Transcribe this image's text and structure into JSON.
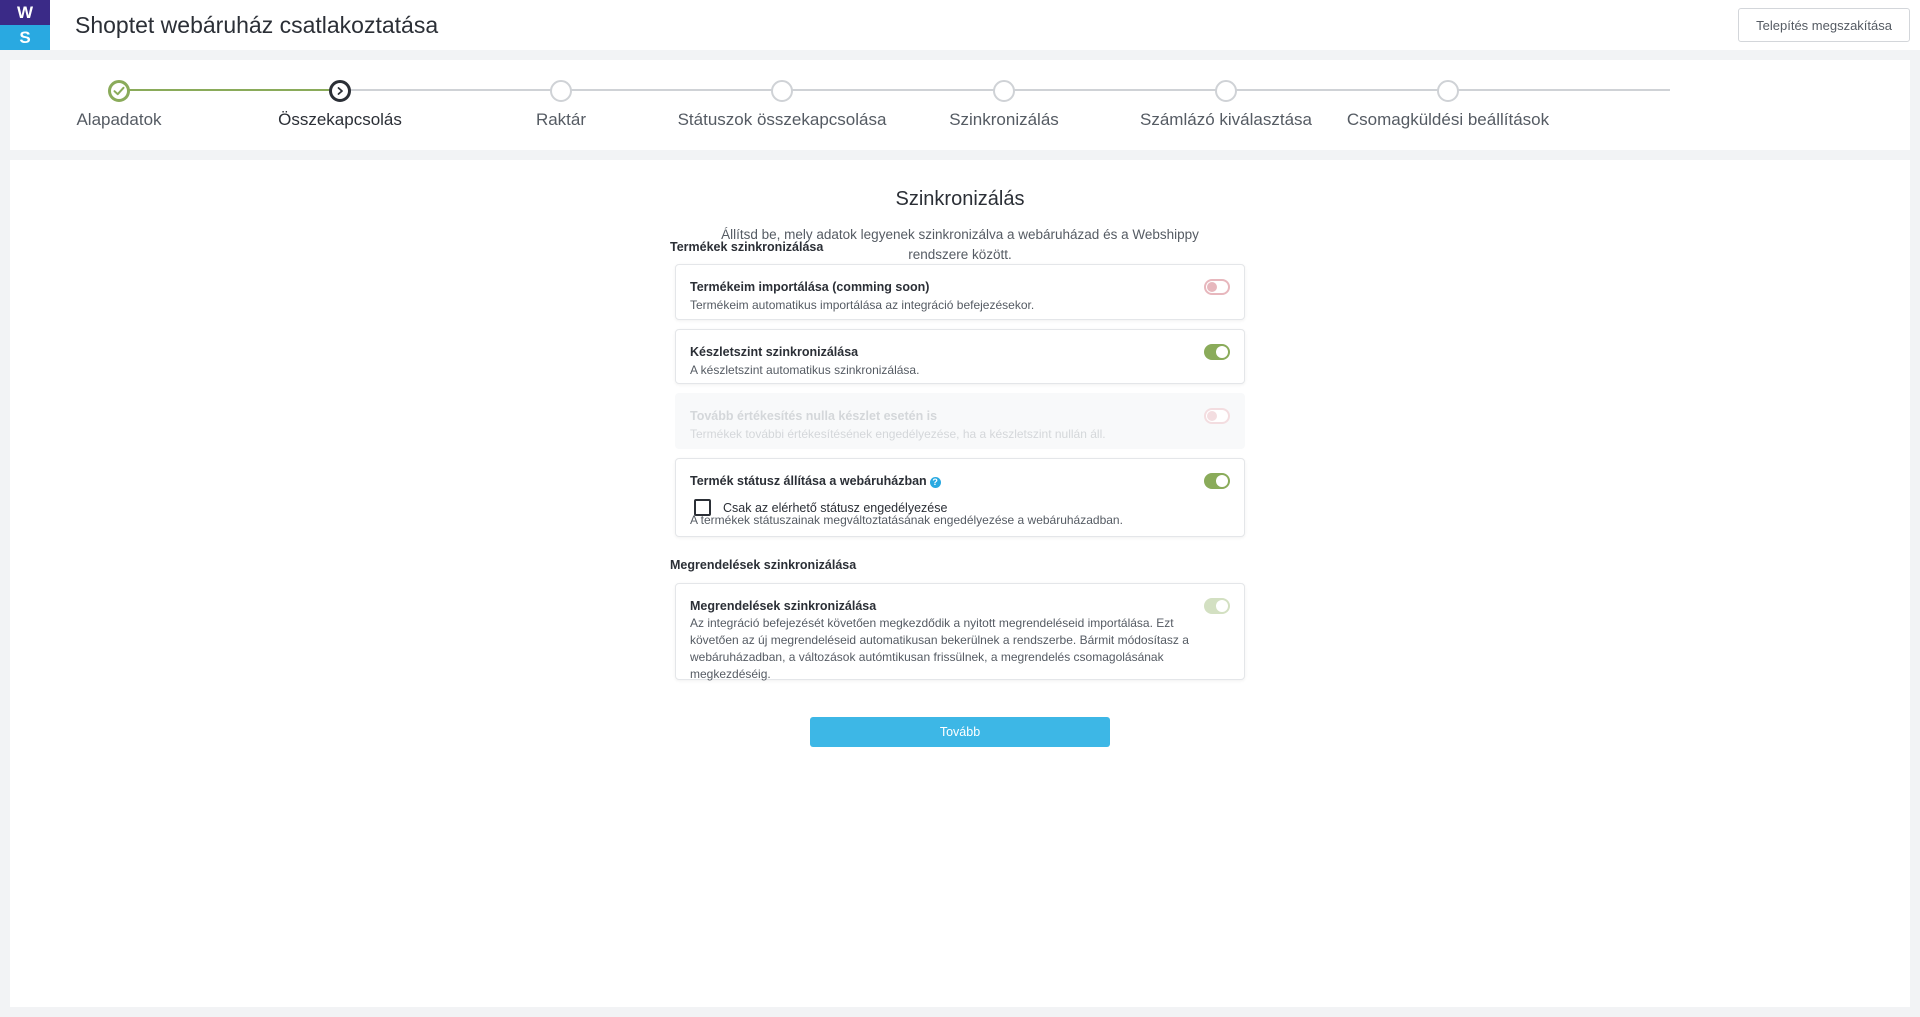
{
  "header": {
    "logo_top": "W",
    "logo_bottom": "S",
    "title": "Shoptet webáruház csatlakoztatása",
    "cancel_label": "Telepítés megszakítása"
  },
  "stepper": {
    "steps": [
      {
        "label": "Alapadatok",
        "state": "done"
      },
      {
        "label": "Összekapcsolás",
        "state": "current"
      },
      {
        "label": "Raktár",
        "state": "pending"
      },
      {
        "label": "Státuszok összekapcsolása",
        "state": "pending"
      },
      {
        "label": "Szinkronizálás",
        "state": "pending"
      },
      {
        "label": "Számlázó kiválasztása",
        "state": "pending"
      },
      {
        "label": "Csomagküldési beállítások",
        "state": "pending"
      }
    ]
  },
  "main": {
    "title": "Szinkronizálás",
    "description": "Állítsd be, mely adatok legyenek szinkronizálva a webáruházad és a Webshippy rendszere között.",
    "products_section": "Termékek szinkronizálása",
    "orders_section": "Megrendelések szinkronizálása",
    "options": {
      "import": {
        "title": "Termékeim importálása (comming soon)",
        "desc": "Termékeim automatikus importálása az integráció befejezésekor.",
        "enabled": false
      },
      "stock": {
        "title": "Készletszint szinkronizálása",
        "desc": "A készletszint automatikus szinkronizálása.",
        "enabled": true
      },
      "zero_stock": {
        "title": "Tovább értékesítés nulla készlet esetén is",
        "desc": "Termékek további értékesítésének engedélyezése, ha a készletszint nullán áll.",
        "enabled": false
      },
      "status": {
        "title": "Termék státusz állítása a webáruházban",
        "checkbox_label": "Csak az elérhető státusz engedélyezése",
        "desc": "A termékek státuszainak megváltoztatásának engedélyezése a webáruházadban.",
        "enabled": true
      },
      "orders": {
        "title": "Megrendelések szinkronizálása",
        "desc": "Az integráció befejezését követően megkezdődik a nyitott megrendeléseid importálása. Ezt követően az új megrendeléseid automatikusan bekerülnek a rendszerbe. Bármit módosítasz a webáruházadban, a változások autómtikusan frissülnek, a megrendelés csomagolásának megkezdéséig.",
        "enabled": true
      }
    },
    "next_label": "Tovább"
  },
  "colors": {
    "brand_purple": "#3a2a87",
    "brand_blue": "#29a9e1",
    "success_green": "#8aab5a",
    "button_blue": "#3db7e6",
    "toggle_off": "#e7b7bd"
  }
}
